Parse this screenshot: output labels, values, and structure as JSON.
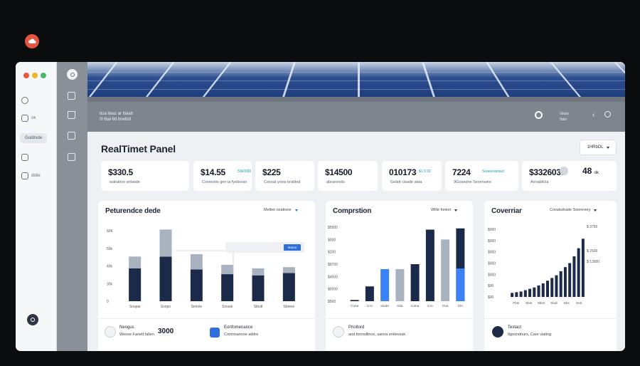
{
  "app": {
    "icon": "cloud-icon"
  },
  "sidebar": {
    "items": [
      {
        "label": "",
        "icon": "eye-icon"
      },
      {
        "label": "ok",
        "icon": "lock-icon"
      },
      {
        "label": "Guidnute",
        "icon": ""
      },
      {
        "label": "",
        "icon": "battery-icon"
      },
      {
        "label": "dldie",
        "icon": "doc-icon"
      }
    ]
  },
  "topbar": {
    "line1": "ltua lteaz ar ltiaatr",
    "line2": "0l 6tal 6tt bnebdl",
    "user_line1": "Glaio",
    "user_line2": "0aio"
  },
  "panel": {
    "title": "RealTimet Panel",
    "range_label": "1HRbDL"
  },
  "kpis": [
    {
      "value": "$330.5",
      "tag": "",
      "label": "wahation snbaide"
    },
    {
      "value": "$14.55",
      "tag": "50k0000",
      "label": "Coneisitis gen ia fyeboran"
    },
    {
      "value": "$225",
      "tag": "",
      "label": "Consat yosis brabled"
    },
    {
      "value": "$14500",
      "tag": "",
      "label": "abrasvisits"
    },
    {
      "value": "010173",
      "tag": "$1 9 02",
      "label": "Gelatt cisade ataa"
    },
    {
      "value": "7224",
      "tag": "Soaeesamaut",
      "label": "9Goaedne Sexenwire"
    },
    {
      "value": "$3326033",
      "tag": "",
      "label": "Aenabilcla"
    }
  ],
  "kpi_extra": {
    "value": "48",
    "unit": "ok"
  },
  "cards": {
    "performance": {
      "title": "Peturendce dede",
      "select": "Mellen oxatione",
      "tooltip_button": "Mutoo",
      "footer": [
        {
          "icon": "wifi-icon",
          "title": "Neogus",
          "subtitle": "Weose Fanett fallen",
          "number": "3000"
        },
        {
          "icon": "check-icon",
          "title": "Eonfomenance",
          "subtitle": "Conmnanvoe addre"
        }
      ]
    },
    "comparison": {
      "title": "Comprstion",
      "select": "Wllle fonion",
      "footer": {
        "icon": "clock-icon",
        "title": "Prioltord",
        "subtitle": "and fonrsdlinos, sanna entlevsak"
      }
    },
    "coverage": {
      "title": "Coverriar",
      "select": "Covalsdrade Soorevery",
      "footer": {
        "icon": "avatar-icon",
        "title": "Textact",
        "subtitle": "Itgosndnurs, Care viating"
      }
    }
  },
  "chart_data": [
    {
      "type": "bar",
      "title": "Peturendce dede",
      "categories": [
        "Soupai",
        "Ssnpo",
        "Senole",
        "Sooals",
        "Sibutl",
        "Sbnine"
      ],
      "yticks": [
        "60K",
        "50k",
        "40k",
        "30k",
        "0"
      ],
      "ylim": [
        0,
        60
      ],
      "series": [
        {
          "values": [
            28,
            38,
            27,
            23,
            22,
            24
          ],
          "color": "#1c2a4a"
        },
        {
          "values": [
            10,
            23,
            13,
            8,
            6,
            5
          ],
          "color": "#a9b2bf"
        }
      ],
      "legend": "none"
    },
    {
      "type": "bar",
      "title": "Comprstion",
      "categories": [
        "Cvna",
        "Cro",
        "stode",
        "lrda",
        "Cana",
        "Cro",
        "Ova",
        "Cln"
      ],
      "yticks": [
        "$5500",
        "$000",
        "$200",
        "$0700",
        "$4500",
        "$0000",
        "$500"
      ],
      "ylim": [
        0,
        6
      ],
      "values": [
        0.1,
        1.2,
        2.6,
        2.6,
        3.0,
        5.8,
        5.0,
        5.9
      ],
      "colors": [
        "#1c2a4a",
        "#1c2a4a",
        "#3b82f6",
        "#a9b2bf",
        "#1c2a4a",
        "#1c2a4a",
        "#a9b2bf",
        "#1c2a4a"
      ],
      "highlight": {
        "index": 7,
        "fraction": 0.45,
        "color": "#3b82f6"
      }
    },
    {
      "type": "bar",
      "title": "Coverriar",
      "categories": [
        "Fbsi",
        "Sbis",
        "5bss",
        "Sbdl",
        "Sbs",
        "Seit"
      ],
      "yticks": [
        "$000",
        "$000",
        "$000",
        "$000",
        "$000",
        "$00",
        "$00"
      ],
      "right_labels": [
        "$ 3750",
        "$ 2500",
        "$ 13000"
      ],
      "ylim": [
        0,
        100
      ],
      "values": [
        6,
        7,
        8,
        10,
        12,
        14,
        17,
        20,
        24,
        28,
        32,
        38,
        44,
        50,
        60,
        72,
        86
      ],
      "color": "#1c2a4a"
    }
  ]
}
